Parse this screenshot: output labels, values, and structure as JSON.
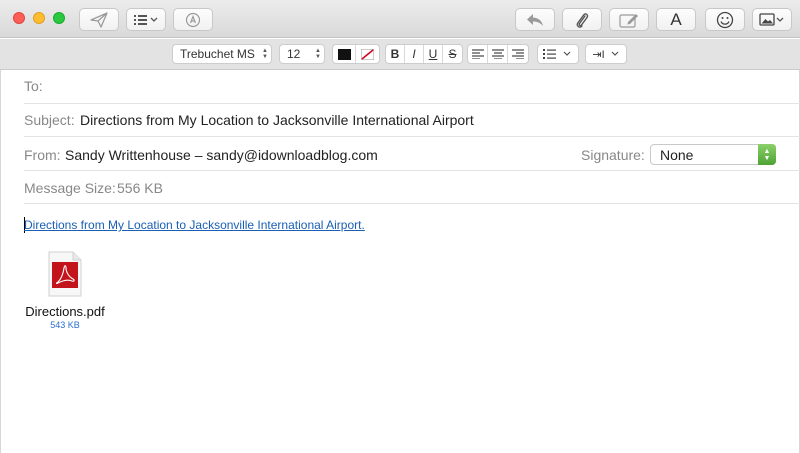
{
  "toolbar": {
    "send": "send-icon",
    "header_fields": "list-icon",
    "markup": "markup-icon",
    "reply": "reply-icon",
    "attach": "paperclip-icon",
    "annotate": "annotate-icon",
    "format_label": "A",
    "emoji": "emoji-icon",
    "photo": "photo-icon"
  },
  "format": {
    "font": "Trebuchet MS",
    "size": "12",
    "bold": "B",
    "italic": "I",
    "underline": "U",
    "strike": "S",
    "indent": "⇥I"
  },
  "header": {
    "to_label": "To:",
    "to_value": "",
    "subject_label": "Subject:",
    "subject_value": "Directions from My Location to Jacksonville International Airport",
    "from_label": "From:",
    "from_value": "Sandy Writtenhouse – sandy@idownloadblog.com",
    "signature_label": "Signature:",
    "signature_value": "None",
    "size_label": "Message Size:",
    "size_value": "556 KB"
  },
  "body": {
    "link_text": "Directions from My Location to Jacksonville International Airport."
  },
  "attachment": {
    "name": "Directions.pdf",
    "size": "543 KB"
  },
  "colors": {
    "link": "#1a5fb4",
    "close": "#fd5f57",
    "minimize": "#febc2e",
    "zoom": "#28c840",
    "pdf_red": "#c4141b"
  }
}
